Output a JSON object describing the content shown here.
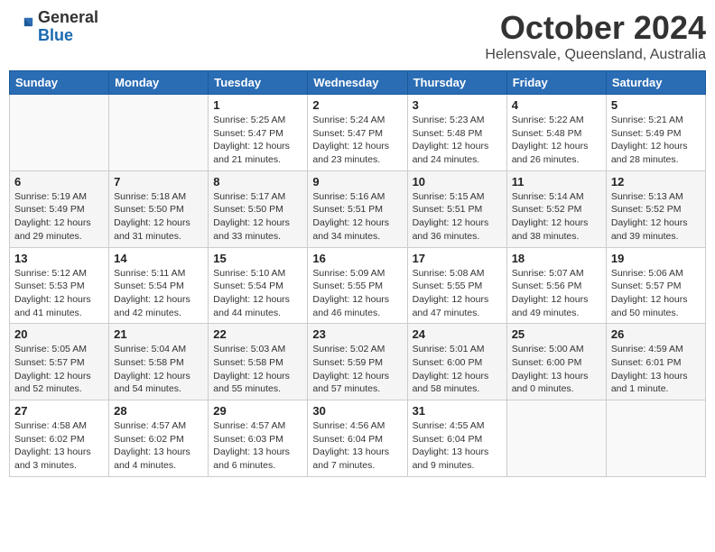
{
  "header": {
    "logo": {
      "line1": "General",
      "line2": "Blue"
    },
    "title": "October 2024",
    "location": "Helensvale, Queensland, Australia"
  },
  "days_of_week": [
    "Sunday",
    "Monday",
    "Tuesday",
    "Wednesday",
    "Thursday",
    "Friday",
    "Saturday"
  ],
  "weeks": [
    [
      {
        "day": "",
        "info": ""
      },
      {
        "day": "",
        "info": ""
      },
      {
        "day": "1",
        "info": "Sunrise: 5:25 AM\nSunset: 5:47 PM\nDaylight: 12 hours and 21 minutes."
      },
      {
        "day": "2",
        "info": "Sunrise: 5:24 AM\nSunset: 5:47 PM\nDaylight: 12 hours and 23 minutes."
      },
      {
        "day": "3",
        "info": "Sunrise: 5:23 AM\nSunset: 5:48 PM\nDaylight: 12 hours and 24 minutes."
      },
      {
        "day": "4",
        "info": "Sunrise: 5:22 AM\nSunset: 5:48 PM\nDaylight: 12 hours and 26 minutes."
      },
      {
        "day": "5",
        "info": "Sunrise: 5:21 AM\nSunset: 5:49 PM\nDaylight: 12 hours and 28 minutes."
      }
    ],
    [
      {
        "day": "6",
        "info": "Sunrise: 5:19 AM\nSunset: 5:49 PM\nDaylight: 12 hours and 29 minutes."
      },
      {
        "day": "7",
        "info": "Sunrise: 5:18 AM\nSunset: 5:50 PM\nDaylight: 12 hours and 31 minutes."
      },
      {
        "day": "8",
        "info": "Sunrise: 5:17 AM\nSunset: 5:50 PM\nDaylight: 12 hours and 33 minutes."
      },
      {
        "day": "9",
        "info": "Sunrise: 5:16 AM\nSunset: 5:51 PM\nDaylight: 12 hours and 34 minutes."
      },
      {
        "day": "10",
        "info": "Sunrise: 5:15 AM\nSunset: 5:51 PM\nDaylight: 12 hours and 36 minutes."
      },
      {
        "day": "11",
        "info": "Sunrise: 5:14 AM\nSunset: 5:52 PM\nDaylight: 12 hours and 38 minutes."
      },
      {
        "day": "12",
        "info": "Sunrise: 5:13 AM\nSunset: 5:52 PM\nDaylight: 12 hours and 39 minutes."
      }
    ],
    [
      {
        "day": "13",
        "info": "Sunrise: 5:12 AM\nSunset: 5:53 PM\nDaylight: 12 hours and 41 minutes."
      },
      {
        "day": "14",
        "info": "Sunrise: 5:11 AM\nSunset: 5:54 PM\nDaylight: 12 hours and 42 minutes."
      },
      {
        "day": "15",
        "info": "Sunrise: 5:10 AM\nSunset: 5:54 PM\nDaylight: 12 hours and 44 minutes."
      },
      {
        "day": "16",
        "info": "Sunrise: 5:09 AM\nSunset: 5:55 PM\nDaylight: 12 hours and 46 minutes."
      },
      {
        "day": "17",
        "info": "Sunrise: 5:08 AM\nSunset: 5:55 PM\nDaylight: 12 hours and 47 minutes."
      },
      {
        "day": "18",
        "info": "Sunrise: 5:07 AM\nSunset: 5:56 PM\nDaylight: 12 hours and 49 minutes."
      },
      {
        "day": "19",
        "info": "Sunrise: 5:06 AM\nSunset: 5:57 PM\nDaylight: 12 hours and 50 minutes."
      }
    ],
    [
      {
        "day": "20",
        "info": "Sunrise: 5:05 AM\nSunset: 5:57 PM\nDaylight: 12 hours and 52 minutes."
      },
      {
        "day": "21",
        "info": "Sunrise: 5:04 AM\nSunset: 5:58 PM\nDaylight: 12 hours and 54 minutes."
      },
      {
        "day": "22",
        "info": "Sunrise: 5:03 AM\nSunset: 5:58 PM\nDaylight: 12 hours and 55 minutes."
      },
      {
        "day": "23",
        "info": "Sunrise: 5:02 AM\nSunset: 5:59 PM\nDaylight: 12 hours and 57 minutes."
      },
      {
        "day": "24",
        "info": "Sunrise: 5:01 AM\nSunset: 6:00 PM\nDaylight: 12 hours and 58 minutes."
      },
      {
        "day": "25",
        "info": "Sunrise: 5:00 AM\nSunset: 6:00 PM\nDaylight: 13 hours and 0 minutes."
      },
      {
        "day": "26",
        "info": "Sunrise: 4:59 AM\nSunset: 6:01 PM\nDaylight: 13 hours and 1 minute."
      }
    ],
    [
      {
        "day": "27",
        "info": "Sunrise: 4:58 AM\nSunset: 6:02 PM\nDaylight: 13 hours and 3 minutes."
      },
      {
        "day": "28",
        "info": "Sunrise: 4:57 AM\nSunset: 6:02 PM\nDaylight: 13 hours and 4 minutes."
      },
      {
        "day": "29",
        "info": "Sunrise: 4:57 AM\nSunset: 6:03 PM\nDaylight: 13 hours and 6 minutes."
      },
      {
        "day": "30",
        "info": "Sunrise: 4:56 AM\nSunset: 6:04 PM\nDaylight: 13 hours and 7 minutes."
      },
      {
        "day": "31",
        "info": "Sunrise: 4:55 AM\nSunset: 6:04 PM\nDaylight: 13 hours and 9 minutes."
      },
      {
        "day": "",
        "info": ""
      },
      {
        "day": "",
        "info": ""
      }
    ]
  ]
}
